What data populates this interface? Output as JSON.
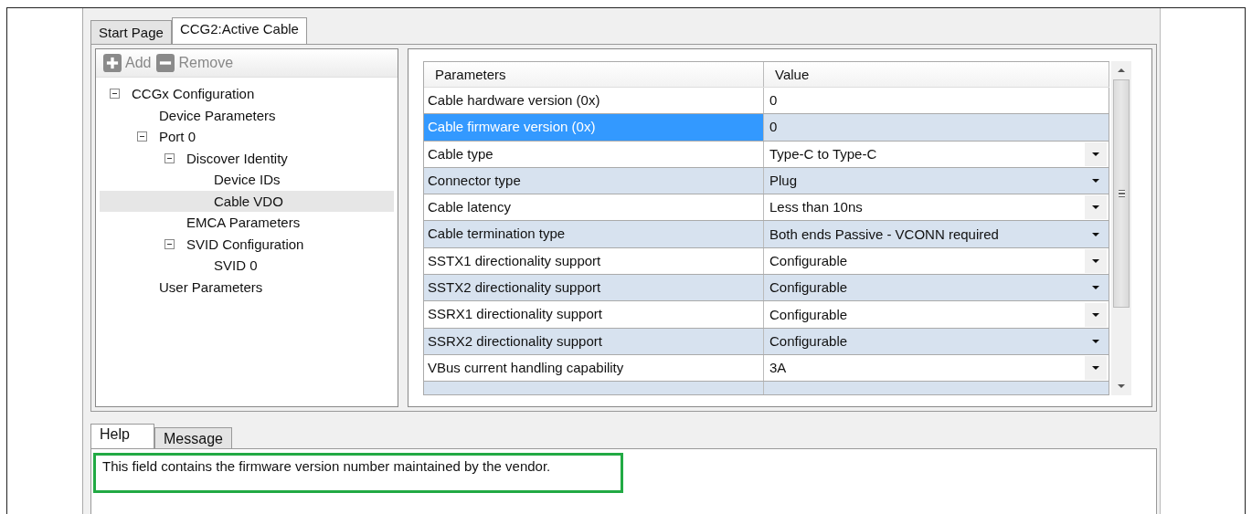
{
  "document_tabs": [
    {
      "label": "Start Page",
      "selected": false
    },
    {
      "label": "CCG2:Active Cable",
      "selected": true
    }
  ],
  "toolbar": [
    {
      "label": "Add",
      "kind": "add",
      "disabled": true
    },
    {
      "label": "Remove",
      "kind": "remove",
      "disabled": true
    }
  ],
  "tree": [
    {
      "label": "CCGx Configuration",
      "expanded": true,
      "selected": false,
      "children": [
        {
          "label": "Device Parameters",
          "selected": false
        },
        {
          "label": "Port 0",
          "expanded": true,
          "selected": false,
          "children": [
            {
              "label": "Discover Identity",
              "expanded": true,
              "selected": false,
              "children": [
                {
                  "label": "Device IDs",
                  "selected": false
                },
                {
                  "label": "Cable VDO",
                  "selected": true
                }
              ]
            },
            {
              "label": "EMCA Parameters",
              "selected": false
            },
            {
              "label": "SVID Configuration",
              "expanded": true,
              "selected": false,
              "children": [
                {
                  "label": "SVID 0",
                  "selected": false
                }
              ]
            }
          ]
        },
        {
          "label": "User Parameters",
          "selected": false
        }
      ]
    }
  ],
  "table": {
    "columns": [
      "Parameters",
      "Value"
    ],
    "rows": [
      {
        "parameter": "Cable hardware version (0x)",
        "value": "0",
        "kind": "text",
        "selected": false
      },
      {
        "parameter": "Cable firmware version (0x)",
        "value": "0",
        "kind": "text",
        "selected": true
      },
      {
        "parameter": "Cable type",
        "value": "Type-C to Type-C",
        "kind": "dropdown",
        "selected": false
      },
      {
        "parameter": "Connector type",
        "value": "Plug",
        "kind": "dropdown",
        "selected": false
      },
      {
        "parameter": "Cable latency",
        "value": "Less than 10ns",
        "kind": "dropdown",
        "selected": false
      },
      {
        "parameter": "Cable termination type",
        "value": "Both ends Passive - VCONN required",
        "kind": "dropdown",
        "selected": false
      },
      {
        "parameter": "SSTX1 directionality support",
        "value": "Configurable",
        "kind": "dropdown",
        "selected": false
      },
      {
        "parameter": "SSTX2 directionality support",
        "value": "Configurable",
        "kind": "dropdown",
        "selected": false
      },
      {
        "parameter": "SSRX1 directionality support",
        "value": "Configurable",
        "kind": "dropdown",
        "selected": false
      },
      {
        "parameter": "SSRX2 directionality support",
        "value": "Configurable",
        "kind": "dropdown",
        "selected": false
      },
      {
        "parameter": "VBus current handling capability",
        "value": "3A",
        "kind": "dropdown",
        "selected": false
      }
    ]
  },
  "bottom_tabs": [
    {
      "label": "Help",
      "selected": true
    },
    {
      "label": "Message",
      "selected": false
    }
  ],
  "help": {
    "text": "This field contains the firmware version number maintained by the vendor.",
    "highlighted": true
  }
}
